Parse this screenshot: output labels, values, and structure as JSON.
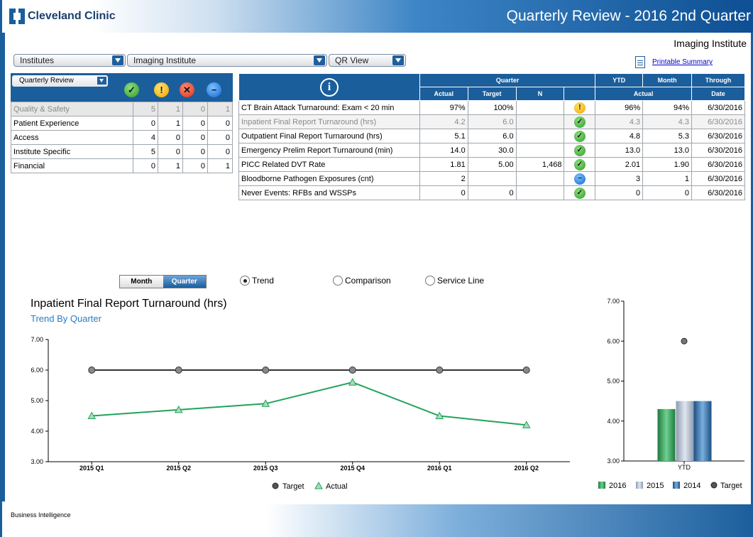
{
  "header": {
    "brand": "Cleveland Clinic",
    "title": "Quarterly Review - 2016 2nd Quarter",
    "subtitle": "Imaging Institute"
  },
  "filters": [
    {
      "value": "Institutes"
    },
    {
      "value": "Imaging Institute"
    },
    {
      "value": "QR View"
    }
  ],
  "printable_link": "Printable Summary",
  "summary": {
    "select_value": "Quarterly Review",
    "status_icons": [
      {
        "name": "check-icon",
        "glyph": "✓",
        "color": "#2f9a2f"
      },
      {
        "name": "warning-icon",
        "glyph": "!",
        "color": "#f3a200"
      },
      {
        "name": "x-icon",
        "glyph": "✕",
        "color": "#d8311a"
      },
      {
        "name": "minus-icon",
        "glyph": "−",
        "color": "#1064d4"
      }
    ],
    "rows": [
      {
        "label": "Quality & Safety",
        "counts": [
          "5",
          "1",
          "0",
          "1"
        ],
        "dim": true
      },
      {
        "label": "Patient Experience",
        "counts": [
          "0",
          "1",
          "0",
          "0"
        ],
        "dim": false
      },
      {
        "label": "Access",
        "counts": [
          "4",
          "0",
          "0",
          "0"
        ],
        "dim": false
      },
      {
        "label": "Institute Specific",
        "counts": [
          "5",
          "0",
          "0",
          "0"
        ],
        "dim": false
      },
      {
        "label": "Financial",
        "counts": [
          "0",
          "1",
          "0",
          "1"
        ],
        "dim": false
      }
    ]
  },
  "metrics": {
    "group_headers": {
      "quarter": "Quarter",
      "ytd": "YTD",
      "month": "Month",
      "through": "Through"
    },
    "sub_headers": {
      "actual": "Actual",
      "target": "Target",
      "n": "N",
      "ytd_month_actual": "Actual",
      "date": "Date"
    },
    "rows": [
      {
        "name": "CT Brain Attack Turnaround: Exam < 20 min",
        "actual": "97%",
        "target": "100%",
        "n": "",
        "status": "warning-icon",
        "ytd": "96%",
        "month": "94%",
        "date": "6/30/2016",
        "dim": false
      },
      {
        "name": "Inpatient Final Report Turnaround (hrs)",
        "actual": "4.2",
        "target": "6.0",
        "n": "",
        "status": "check-icon",
        "ytd": "4.3",
        "month": "4.3",
        "date": "6/30/2016",
        "dim": true
      },
      {
        "name": "Outpatient Final Report Turnaround (hrs)",
        "actual": "5.1",
        "target": "6.0",
        "n": "",
        "status": "check-icon",
        "ytd": "4.8",
        "month": "5.3",
        "date": "6/30/2016",
        "dim": false
      },
      {
        "name": "Emergency Prelim Report Turnaround (min)",
        "actual": "14.0",
        "target": "30.0",
        "n": "",
        "status": "check-icon",
        "ytd": "13.0",
        "month": "13.0",
        "date": "6/30/2016",
        "dim": false
      },
      {
        "name": "PICC Related DVT Rate",
        "actual": "1.81",
        "target": "5.00",
        "n": "1,468",
        "status": "check-icon",
        "ytd": "2.01",
        "month": "1.90",
        "date": "6/30/2016",
        "dim": false
      },
      {
        "name": "Bloodborne Pathogen Exposures (cnt)",
        "actual": "2",
        "target": "",
        "n": "",
        "status": "minus-icon",
        "ytd": "3",
        "month": "1",
        "date": "6/30/2016",
        "dim": false
      },
      {
        "name": "Never Events: RFBs and WSSPs",
        "actual": "0",
        "target": "0",
        "n": "",
        "status": "check-icon",
        "ytd": "0",
        "month": "0",
        "date": "6/30/2016",
        "dim": false
      }
    ]
  },
  "view_controls": {
    "toggle": {
      "month": "Month",
      "quarter": "Quarter",
      "selected": "Quarter"
    },
    "radios": [
      {
        "label": "Trend",
        "selected": true
      },
      {
        "label": "Comparison",
        "selected": false
      },
      {
        "label": "Service Line",
        "selected": false
      }
    ]
  },
  "chart_heading": {
    "title": "Inpatient Final Report Turnaround (hrs)",
    "subtitle": "Trend By Quarter"
  },
  "chart_data": [
    {
      "type": "line",
      "categories": [
        "2015 Q1",
        "2015 Q2",
        "2015 Q3",
        "2015 Q4",
        "2016 Q1",
        "2016 Q2"
      ],
      "series": [
        {
          "name": "Target",
          "values": [
            6.0,
            6.0,
            6.0,
            6.0,
            6.0,
            6.0
          ],
          "color": "#333333",
          "marker": "circle"
        },
        {
          "name": "Actual",
          "values": [
            4.5,
            4.7,
            4.9,
            5.6,
            4.5,
            4.2
          ],
          "color": "#21a35a",
          "marker": "triangle"
        }
      ],
      "yticks": [
        "7.00",
        "6.00",
        "5.00",
        "4.00",
        "3.00"
      ],
      "ylim": [
        3,
        7
      ],
      "legend": "bottom-center"
    },
    {
      "type": "bar",
      "categories": [
        "YTD"
      ],
      "series": [
        {
          "name": "2016",
          "values": [
            4.3
          ],
          "color": "#2e9a55"
        },
        {
          "name": "2015",
          "values": [
            4.5
          ],
          "color": "#a7b4c8"
        },
        {
          "name": "2014",
          "values": [
            4.5
          ],
          "color": "#2f6ea8"
        },
        {
          "name": "Target",
          "values": [
            6.0
          ],
          "color": "#444444",
          "marker": "circle"
        }
      ],
      "yticks": [
        "7.00",
        "6.00",
        "5.00",
        "4.00",
        "3.00"
      ],
      "ylim": [
        3,
        7
      ],
      "legend": "bottom"
    }
  ],
  "footer": {
    "text": "Business Intelligence"
  }
}
